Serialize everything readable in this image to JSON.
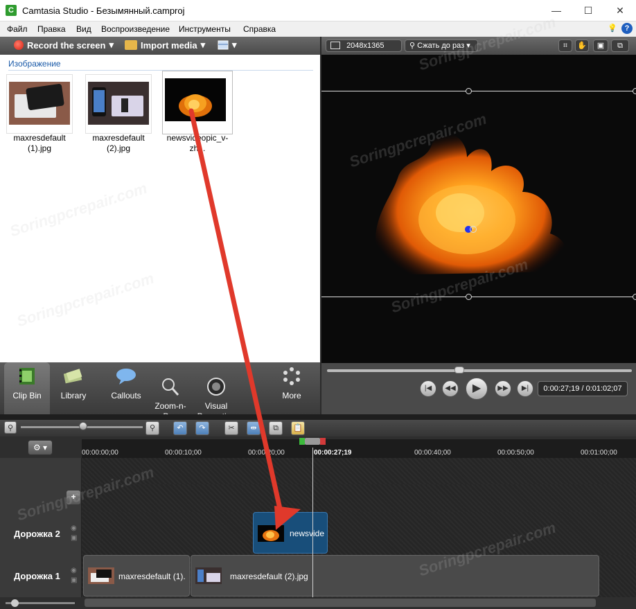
{
  "window": {
    "title": "Camtasia Studio - Безымянный.camproj",
    "app_icon": "C",
    "minimize": "—",
    "maximize": "☐",
    "close": "✕"
  },
  "menu": [
    "Файл",
    "Правка",
    "Вид",
    "Воспроизведение",
    "Инструменты",
    "Справка"
  ],
  "menu_icons": {
    "hint": "💡",
    "help": "?"
  },
  "toolbar": {
    "record_label": "Record the screen",
    "import_label": "Import media",
    "dropdown_arrow": "▾"
  },
  "clip_bin": {
    "section_title": "Изображение",
    "items": [
      {
        "label": "maxresdefault (1).jpg"
      },
      {
        "label": "maxresdefault (2).jpg"
      },
      {
        "label": "newsvideopic_v-zh..."
      }
    ]
  },
  "preview": {
    "dimensions": "2048x1365",
    "zoom_label": "Сжать до раз",
    "time": "0:00:27;19 / 0:01:02;07"
  },
  "tasks": [
    {
      "label": "Clip Bin",
      "icon": "film-icon",
      "active": true
    },
    {
      "label": "Library",
      "icon": "library-icon",
      "active": false
    },
    {
      "label": "Callouts",
      "icon": "speech-bubble-icon",
      "active": false
    },
    {
      "label": "Zoom-n-\nPan",
      "icon": "magnifier-icon",
      "active": false
    },
    {
      "label": "Visual\nProperties",
      "icon": "visual-properties-icon",
      "active": false
    },
    {
      "label": "More",
      "icon": "more-dots-icon",
      "active": false
    }
  ],
  "timeline": {
    "ticks": [
      "00:00:00;00",
      "00:00:10;00",
      "00:00:20;00",
      "00:00:40;00",
      "00:00:50;00",
      "00:01:00;00"
    ],
    "playhead": "00:00:27;19",
    "tracks": [
      {
        "name": "Дорожка 2",
        "clips": [
          "newsvide"
        ]
      },
      {
        "name": "Дорожка 1",
        "clips": [
          "maxresdefault (1).",
          "maxresdefault (2).jpg"
        ]
      }
    ],
    "add_track": "+",
    "gear": "⚙ ▾"
  },
  "watermark": "Soringpcrepair.com",
  "colors": {
    "accent": "#1a5aa8",
    "arrow": "#e0392b",
    "clip_blue": "#184e7a"
  }
}
